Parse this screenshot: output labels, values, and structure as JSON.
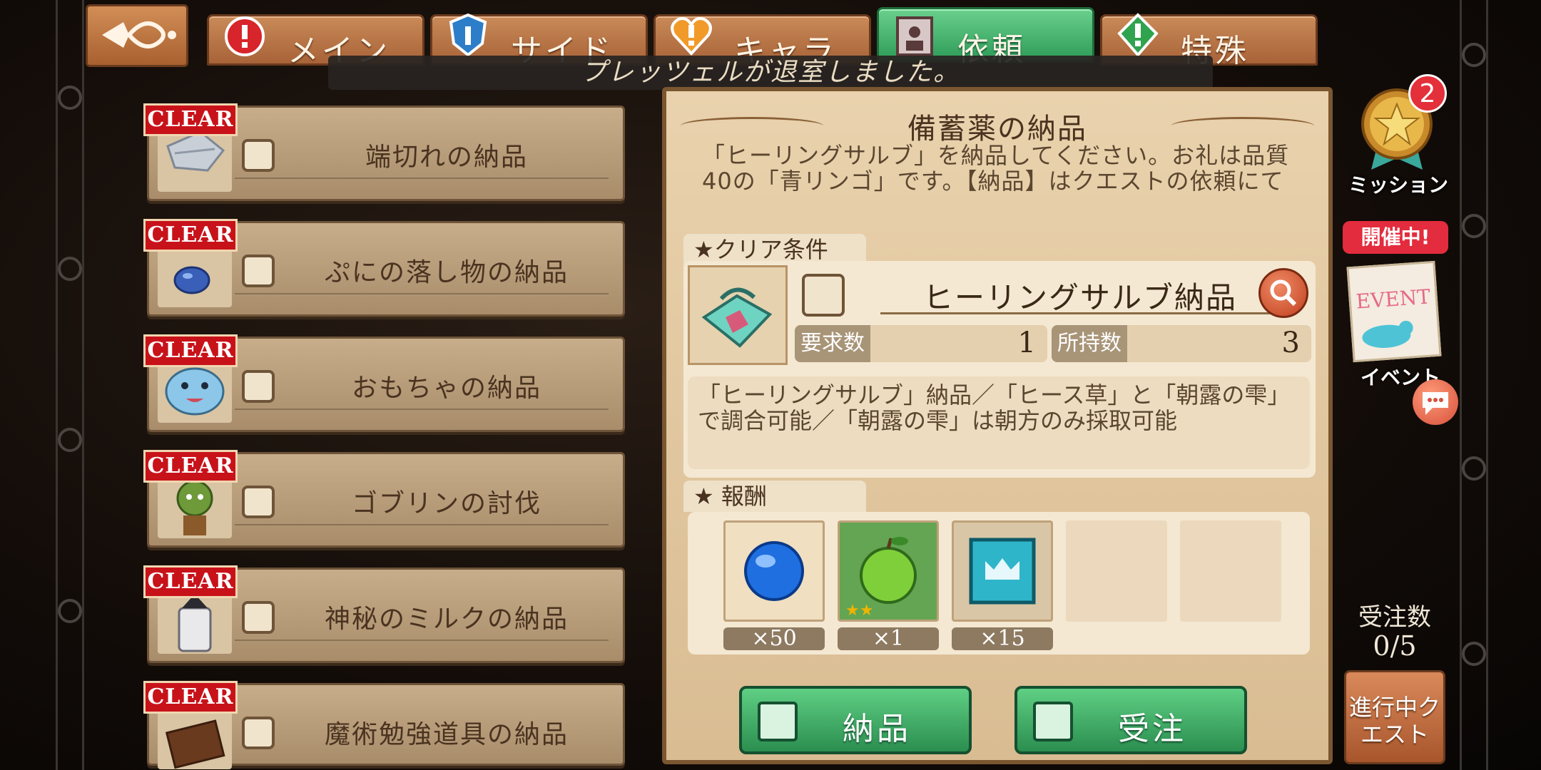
{
  "tabs": [
    {
      "label": "メイン",
      "icon": "red-exclamation-icon"
    },
    {
      "label": "サイド",
      "icon": "blue-shield-icon"
    },
    {
      "label": "キャラ",
      "icon": "orange-heart-icon"
    },
    {
      "label": "依頼",
      "icon": "portrait-icon",
      "active": true
    },
    {
      "label": "特殊",
      "icon": "green-exclamation-icon"
    }
  ],
  "notice": "プレッツェルが退室しました。",
  "quests": [
    {
      "badge": "CLEAR",
      "title": "端切れの納品",
      "type_icon": "delivery-icon",
      "thumb": "cloth-scraps"
    },
    {
      "badge": "CLEAR",
      "title": "ぷにの落し物の納品",
      "type_icon": "delivery-icon",
      "thumb": "blue-gem"
    },
    {
      "badge": "CLEAR",
      "title": "おもちゃの納品",
      "type_icon": "delivery-icon",
      "thumb": "blue-slime-toy"
    },
    {
      "badge": "CLEAR",
      "title": "ゴブリンの討伐",
      "type_icon": "monster-icon",
      "thumb": "goblin"
    },
    {
      "badge": "CLEAR",
      "title": "神秘のミルクの納品",
      "type_icon": "delivery-icon",
      "thumb": "milk-jar"
    },
    {
      "badge": "CLEAR",
      "title": "魔術勉強道具の納品",
      "type_icon": "delivery-icon",
      "thumb": "book"
    }
  ],
  "detail": {
    "title": "備蓄薬の納品",
    "description": "「ヒーリングサルブ」を納品してください。お礼は品質40の「青リンゴ」です。【納品】はクエストの依頼にて",
    "clear_section_label": "クリア条件",
    "condition_name": "ヒーリングサルブ納品",
    "required_label": "要求数",
    "required_value": "1",
    "owned_label": "所持数",
    "owned_value": "3",
    "hint": "「ヒーリングサルブ」納品／「ヒース草」と「朝露の雫」で調合可能／「朝露の雫」は朝方のみ採取可能",
    "reward_section_label": "報酬",
    "rewards": [
      {
        "item": "blue-orb",
        "qty": "×50"
      },
      {
        "item": "green-apple",
        "qty": "×1",
        "stars": 2
      },
      {
        "item": "crown-card",
        "qty": "×15"
      }
    ],
    "deliver_button": "納品",
    "accept_button": "受注"
  },
  "side": {
    "mission_badge": "2",
    "mission_label": "ミッション",
    "event_pill": "開催中!",
    "event_card_text": "EVENT",
    "event_label": "イベント",
    "order_count_label": "受注数",
    "order_count_value": "0/5",
    "progress_quest_label": "進行中クエスト"
  },
  "colors": {
    "tab_inactive": "#b8733f",
    "tab_active": "#3fae66",
    "clear_badge": "#c8121a",
    "green_button": "#3fae66"
  }
}
